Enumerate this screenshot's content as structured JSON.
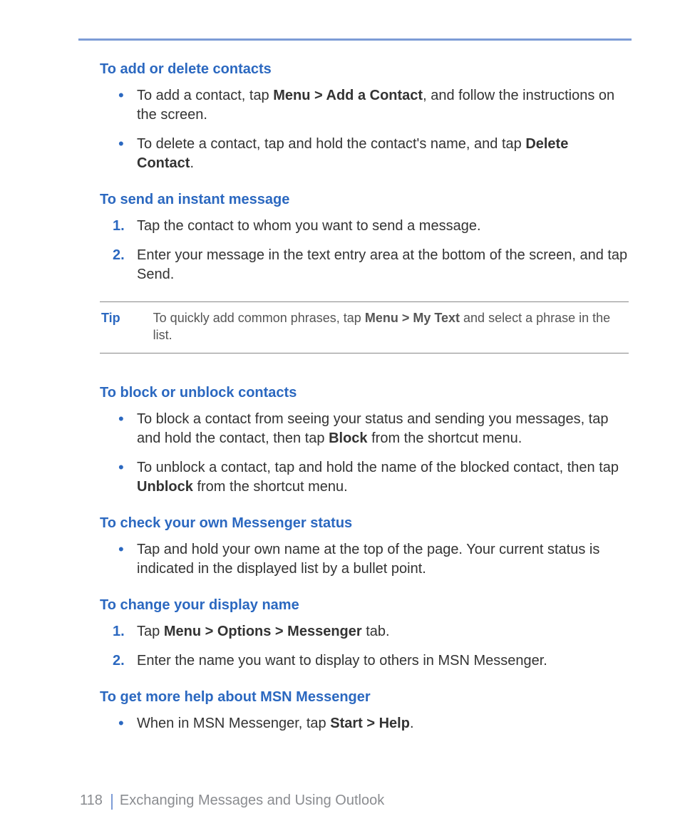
{
  "footer": {
    "page": "118",
    "chapter": "Exchanging Messages and Using Outlook"
  },
  "sections": {
    "addDelete": {
      "heading": "To add or delete contacts",
      "b1_a": "To add a contact, tap ",
      "b1_bold": "Menu > Add a Contact",
      "b1_b": ", and follow the instructions on the screen.",
      "b2_a": "To delete a contact, tap and hold the contact's name, and tap ",
      "b2_bold": "Delete Contact",
      "b2_b": "."
    },
    "sendIM": {
      "heading": "To send an instant message",
      "n1": "Tap the contact to whom you want to send a message.",
      "n2": "Enter your message in the text entry area at the bottom of the screen, and tap Send."
    },
    "tip": {
      "label": "Tip",
      "t_a": "To quickly add common phrases, tap ",
      "t_bold": "Menu > My Text",
      "t_b": " and select a phrase in the list."
    },
    "block": {
      "heading": "To block or unblock contacts",
      "b1_a": "To block a contact from seeing your status and sending you messages, tap and hold the contact, then tap ",
      "b1_bold": "Block",
      "b1_b": " from the shortcut menu.",
      "b2_a": "To unblock a contact, tap and hold the name of the blocked contact, then tap ",
      "b2_bold": "Unblock",
      "b2_b": " from the shortcut menu."
    },
    "status": {
      "heading": "To check your own Messenger status",
      "b1": "Tap and hold your own name at the top of the page. Your current status is indicated in the displayed list by a bullet point."
    },
    "displayName": {
      "heading": "To change your display name",
      "n1_a": "Tap ",
      "n1_bold": "Menu > Options > Messenger",
      "n1_b": " tab.",
      "n2": "Enter the name you want to display to others in MSN Messenger."
    },
    "help": {
      "heading": "To get more help about MSN Messenger",
      "b1_a": "When in MSN Messenger, tap ",
      "b1_bold": "Start > Help",
      "b1_b": "."
    }
  },
  "numbers": {
    "one": "1.",
    "two": "2."
  }
}
